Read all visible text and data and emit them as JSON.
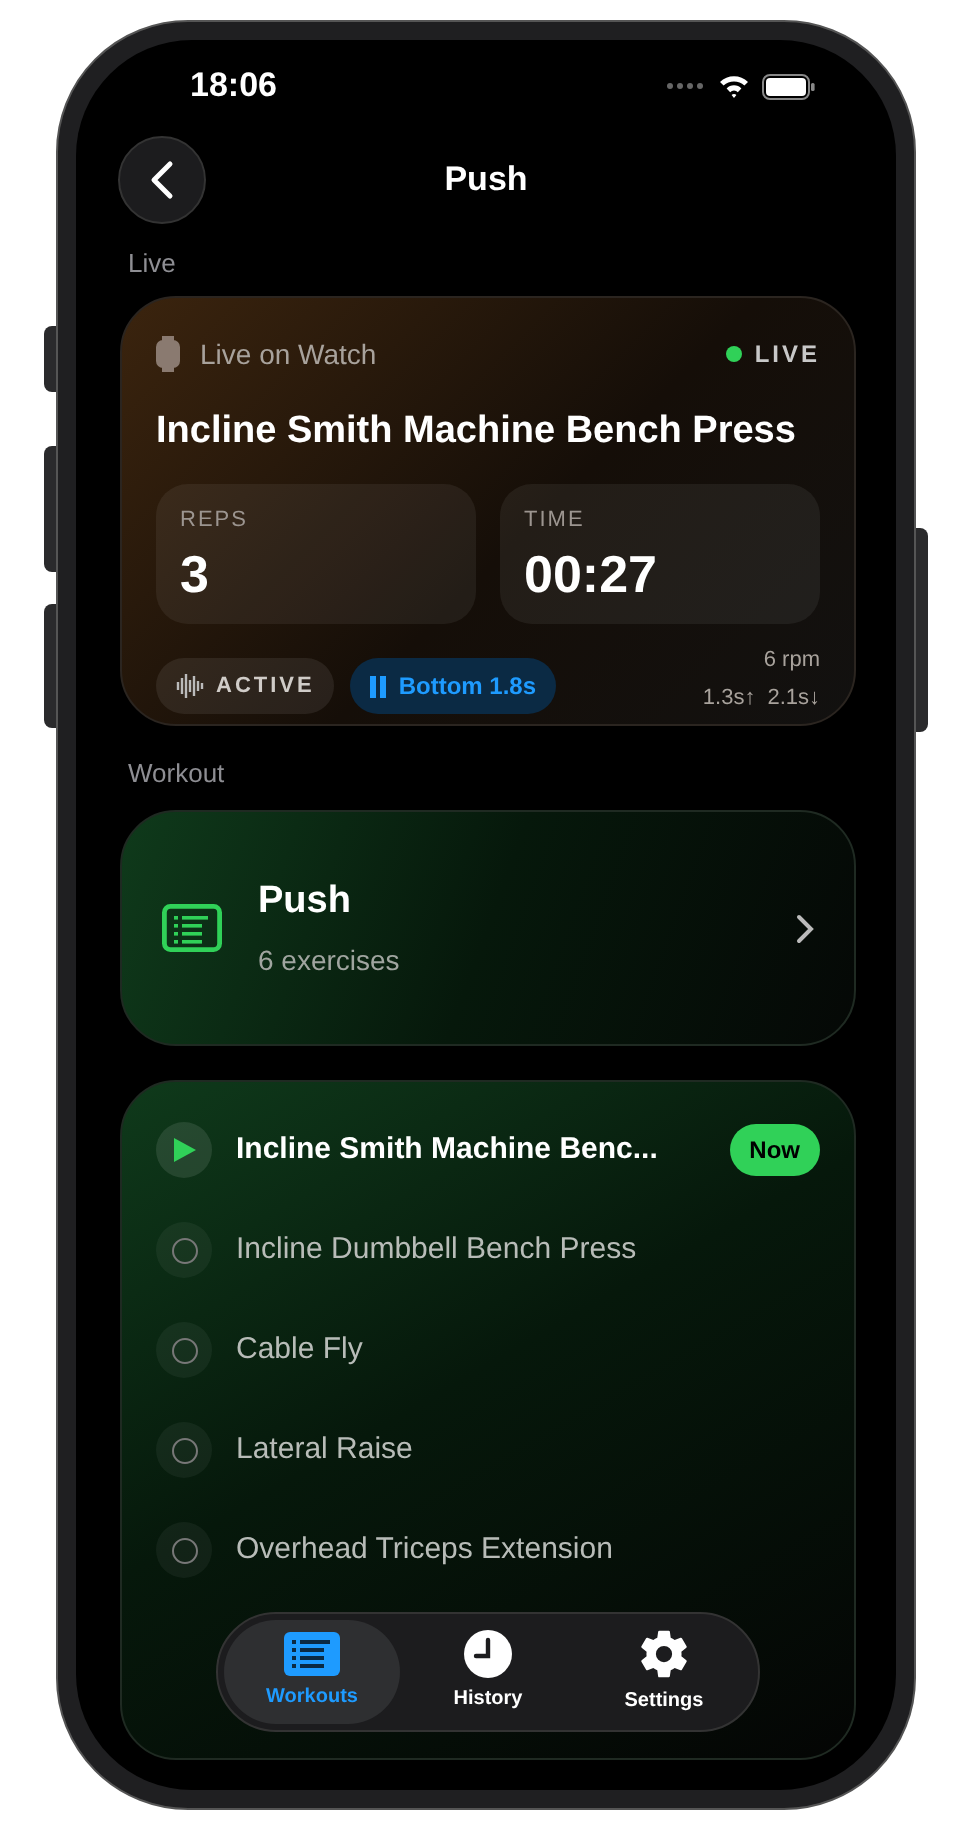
{
  "status_bar": {
    "time": "18:06"
  },
  "header": {
    "title": "Push"
  },
  "live_section": {
    "label": "Live",
    "card": {
      "source": "Live on Watch",
      "status": "LIVE",
      "live": true,
      "exercise": "Incline Smith Machine Bench Press",
      "stats": [
        {
          "label": "REPS",
          "value": "3"
        },
        {
          "label": "TIME",
          "value": "00:27"
        }
      ],
      "state_chip": "ACTIVE",
      "phase_chip": "Bottom 1.8s",
      "rate": "6 rpm",
      "tempo_up": "1.3s↑",
      "tempo_down": "2.1s↓"
    }
  },
  "workout_section": {
    "label": "Workout",
    "card": {
      "title": "Push",
      "subtitle": "6 exercises"
    }
  },
  "exercises": [
    {
      "name": "Incline Smith Machine Benc...",
      "selected": true,
      "badge": "Now"
    },
    {
      "name": "Incline Dumbbell Bench Press",
      "selected": false
    },
    {
      "name": "Cable Fly",
      "selected": false
    },
    {
      "name": "Lateral Raise",
      "selected": false
    },
    {
      "name": "Overhead Triceps Extension",
      "selected": false
    }
  ],
  "tab_bar": [
    {
      "label": "Workouts",
      "selected": true
    },
    {
      "label": "History",
      "selected": false
    },
    {
      "label": "Settings",
      "selected": false
    }
  ]
}
